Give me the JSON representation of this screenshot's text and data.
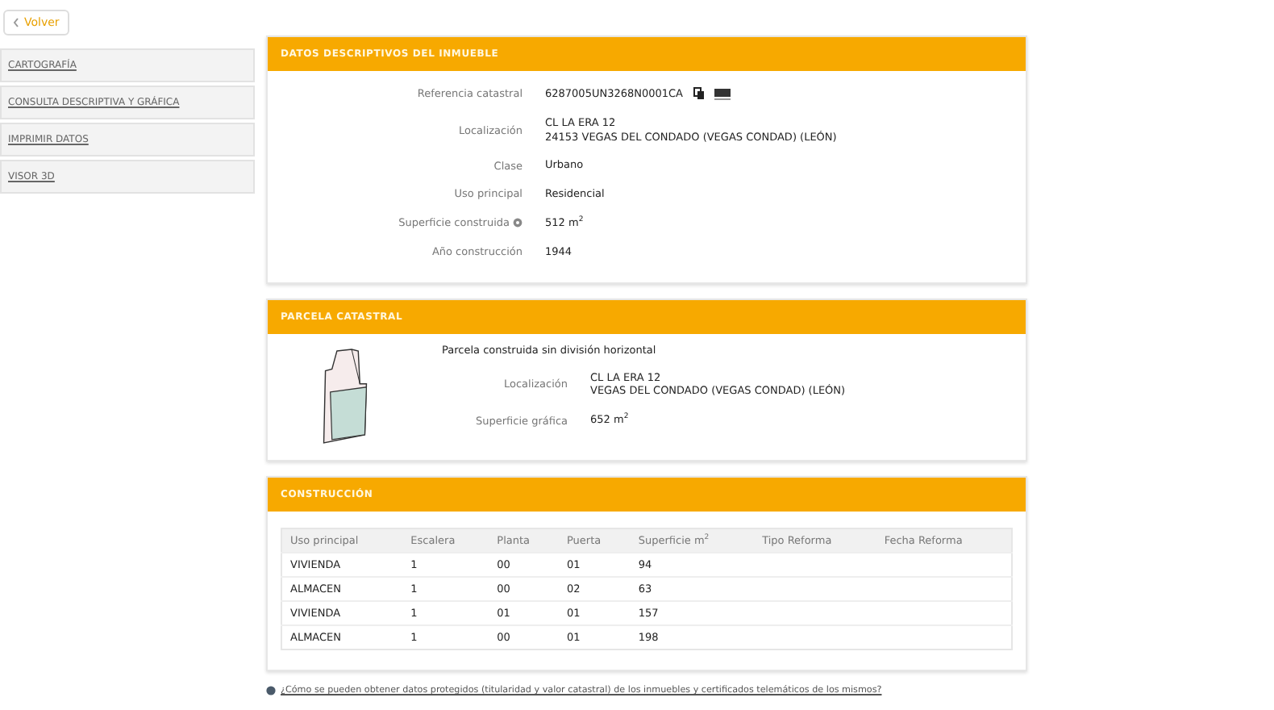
{
  "back_button": {
    "label": "Volver"
  },
  "sidebar": {
    "items": [
      {
        "label": "CARTOGRAFÍA"
      },
      {
        "label": "CONSULTA DESCRIPTIVA Y GRÁFICA"
      },
      {
        "label": "IMPRIMIR DATOS"
      },
      {
        "label": "VISOR 3D"
      }
    ]
  },
  "datos": {
    "title": "DATOS DESCRIPTIVOS DEL INMUEBLE",
    "fields": [
      {
        "kind": "ref",
        "label": "Referencia catastral",
        "value": [
          "6287005UN3268N0001CA"
        ]
      },
      {
        "kind": "text",
        "label": "Localización",
        "value": [
          "CL LA ERA 12",
          "24153 VEGAS DEL CONDADO (VEGAS CONDAD) (LEÓN)"
        ]
      },
      {
        "kind": "text",
        "label": "Clase",
        "value": [
          "Urbano"
        ]
      },
      {
        "kind": "text",
        "label": "Uso principal",
        "value": [
          "Residencial"
        ]
      },
      {
        "kind": "info",
        "label": "Superficie construida",
        "value": [
          "512 m$^{2}$"
        ]
      },
      {
        "kind": "text",
        "label": "Año construcción",
        "value": [
          "1944"
        ]
      }
    ]
  },
  "parcela": {
    "title": "PARCELA CATASTRAL",
    "description": "Parcela construida sin división horizontal",
    "fields": [
      {
        "label": "Localización",
        "value": [
          "CL LA ERA 12",
          "VEGAS DEL CONDADO (VEGAS CONDAD) (LEÓN)"
        ]
      },
      {
        "label": "Superficie gráfica",
        "value": [
          "652 m$^{2}$"
        ]
      }
    ]
  },
  "construccion": {
    "title": "CONSTRUCCIÓN",
    "columns": [
      "Uso principal",
      "Escalera",
      "Planta",
      "Puerta",
      "Superficie m$^{2}$",
      "Tipo Reforma",
      "Fecha Reforma"
    ],
    "rows": [
      [
        "VIVIENDA",
        "1",
        "00",
        "01",
        "94",
        "",
        ""
      ],
      [
        "ALMACEN",
        "1",
        "00",
        "02",
        "63",
        "",
        ""
      ],
      [
        "VIVIENDA",
        "1",
        "01",
        "01",
        "157",
        "",
        ""
      ],
      [
        "ALMACEN",
        "1",
        "00",
        "01",
        "198",
        "",
        ""
      ]
    ]
  },
  "footer_link": "¿Cómo se pueden obtener datos protegidos (titularidad y valor catastral) de los inmuebles y certificados telemáticos de los mismos?"
}
